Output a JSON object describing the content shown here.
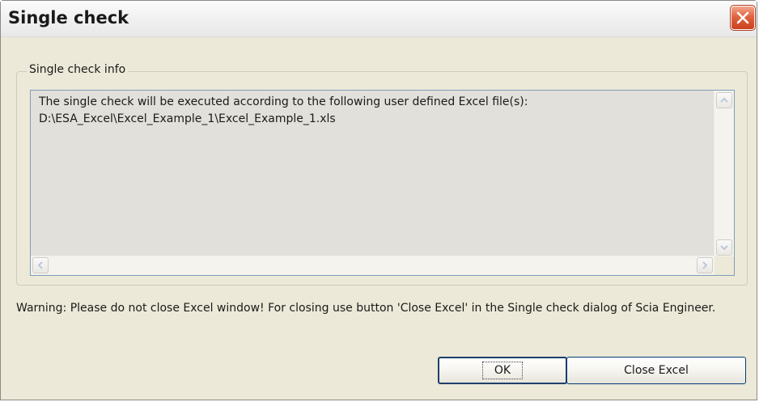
{
  "window": {
    "title": "Single check",
    "close_icon": "close-x-icon"
  },
  "groupbox": {
    "legend": "Single check info"
  },
  "info_text": {
    "lines": [
      "The single check will be executed according to the following user defined Excel file(s):",
      "D:\\ESA_Excel\\Excel_Example_1\\Excel_Example_1.xls"
    ]
  },
  "scrollbars": {
    "up_icon": "chevron-up-icon",
    "down_icon": "chevron-down-icon",
    "left_icon": "chevron-left-icon",
    "right_icon": "chevron-right-icon"
  },
  "warning": {
    "text": "Warning: Please do not close Excel window! For closing use button 'Close Excel' in the Single check dialog of Scia Engineer."
  },
  "buttons": {
    "ok_label": "OK",
    "close_excel_label": "Close Excel"
  },
  "colors": {
    "dialog_bg": "#ece9d8",
    "close_button": "#e0643f",
    "textarea_bg": "#e2e0da"
  }
}
